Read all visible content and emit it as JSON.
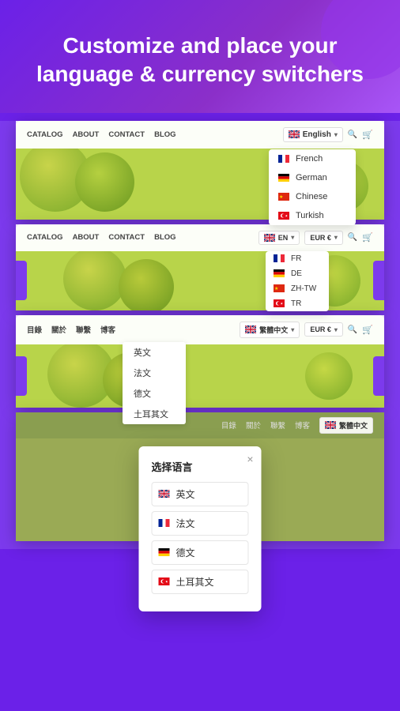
{
  "hero": {
    "title": "Customize and place your language & currency switchers"
  },
  "mockup1": {
    "nav": {
      "links": [
        "CATALOG",
        "ABOUT",
        "CONTACT",
        "BLOG"
      ],
      "lang": "English",
      "chevron": "▾"
    },
    "dropdown": {
      "items": [
        {
          "flag": "fr",
          "label": "French"
        },
        {
          "flag": "de",
          "label": "German"
        },
        {
          "flag": "cn",
          "label": "Chinese"
        },
        {
          "flag": "tr",
          "label": "Turkish"
        }
      ]
    }
  },
  "mockup2": {
    "nav": {
      "links": [
        "CATALOG",
        "ABOUT",
        "CONTACT",
        "BLOG"
      ],
      "lang": "EN",
      "currency": "EUR €",
      "chevron": "▾"
    },
    "dropdown": {
      "items": [
        {
          "flag": "fr",
          "label": "FR"
        },
        {
          "flag": "de",
          "label": "DE"
        },
        {
          "flag": "cn",
          "label": "ZH-TW"
        },
        {
          "flag": "tr",
          "label": "TR"
        }
      ]
    }
  },
  "mockup3": {
    "nav": {
      "links": [
        "目錄",
        "關於",
        "聯繫",
        "博客"
      ],
      "lang": "繁體中文",
      "currency": "EUR €",
      "chevron": "▾"
    },
    "dropdown": {
      "items": [
        {
          "label": "英文"
        },
        {
          "label": "法文"
        },
        {
          "label": "德文"
        },
        {
          "label": "土耳其文"
        }
      ]
    }
  },
  "mockup4": {
    "nav": {
      "links": [
        "目錄",
        "關於",
        "聯繫",
        "博客"
      ],
      "lang": "繁體中文"
    },
    "modal": {
      "title": "选择语言",
      "close": "×",
      "items": [
        {
          "flag": "uk",
          "label": "英文"
        },
        {
          "flag": "fr",
          "label": "法文"
        },
        {
          "flag": "de",
          "label": "德文"
        },
        {
          "flag": "tr",
          "label": "土耳其文"
        }
      ]
    }
  }
}
